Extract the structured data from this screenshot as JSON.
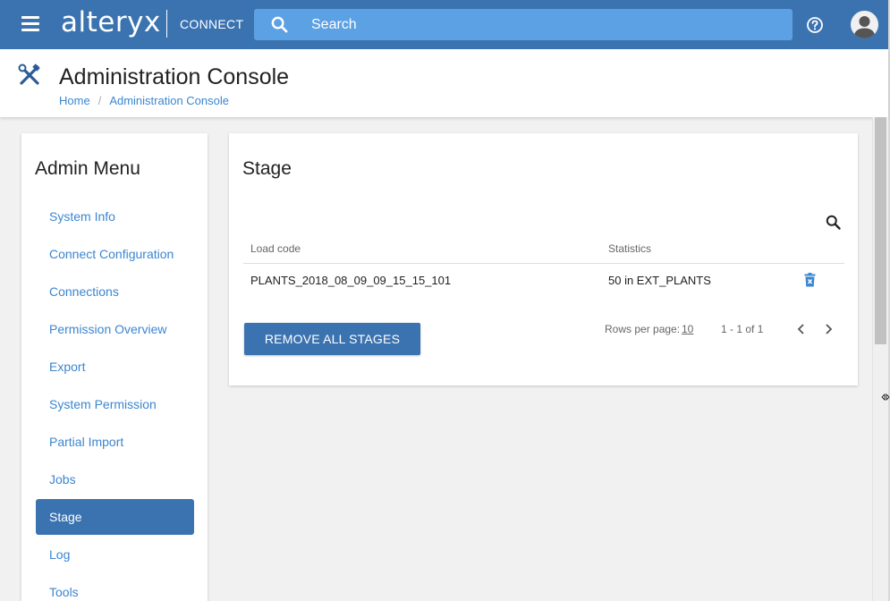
{
  "topbar": {
    "logo": "alteryx",
    "logo_sub": "CONNECT",
    "search_placeholder": "Search",
    "icons": [
      "menu-icon",
      "search-icon",
      "help-icon",
      "user-avatar-icon"
    ]
  },
  "header": {
    "title": "Administration Console",
    "icon": "tools-icon",
    "breadcrumb": [
      "Home",
      "Administration Console"
    ]
  },
  "admin_menu": {
    "title": "Admin Menu",
    "items": [
      {
        "label": "System Info",
        "active": false
      },
      {
        "label": "Connect Configuration",
        "active": false
      },
      {
        "label": "Connections",
        "active": false
      },
      {
        "label": "Permission Overview",
        "active": false
      },
      {
        "label": "Export",
        "active": false
      },
      {
        "label": "System Permission",
        "active": false
      },
      {
        "label": "Partial Import",
        "active": false
      },
      {
        "label": "Jobs",
        "active": false
      },
      {
        "label": "Stage",
        "active": true
      },
      {
        "label": "Log",
        "active": false
      },
      {
        "label": "Tools",
        "active": false
      }
    ]
  },
  "stage": {
    "title": "Stage",
    "columns": [
      "Load code",
      "Statistics"
    ],
    "rows": [
      {
        "load_code": "PLANTS_2018_08_09_09_15_15_101",
        "statistics": "50 in EXT_PLANTS"
      }
    ],
    "remove_button": "REMOVE ALL STAGES",
    "pagination": {
      "rows_per_page_label": "Rows per page:",
      "rows_per_page": "10",
      "range": "1 - 1 of 1"
    }
  },
  "colors": {
    "primary": "#3b73b1",
    "search_bg": "#5ca1e3",
    "link": "#3b86d0",
    "background": "#f1f1f1"
  }
}
